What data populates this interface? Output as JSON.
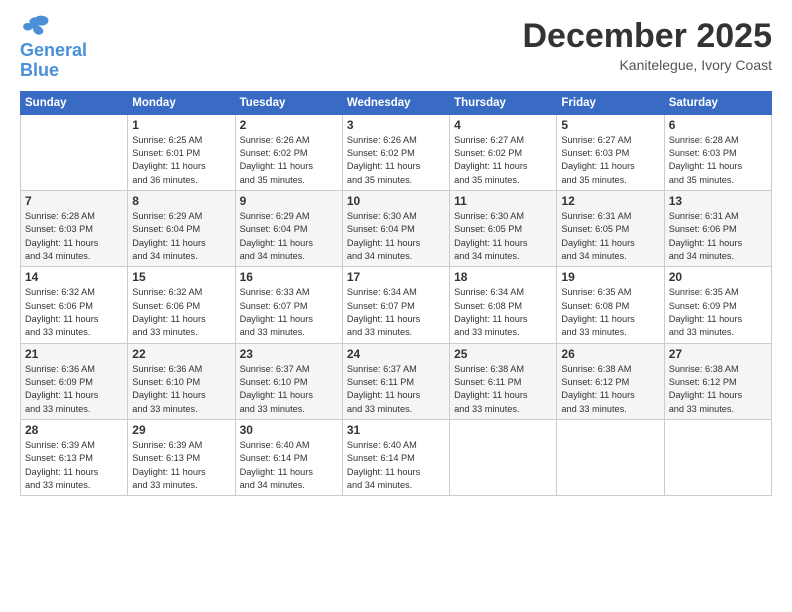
{
  "logo": {
    "line1": "General",
    "line2": "Blue"
  },
  "title": "December 2025",
  "subtitle": "Kanitelegue, Ivory Coast",
  "days_of_week": [
    "Sunday",
    "Monday",
    "Tuesday",
    "Wednesday",
    "Thursday",
    "Friday",
    "Saturday"
  ],
  "weeks": [
    [
      {
        "day": "",
        "info": ""
      },
      {
        "day": "1",
        "info": "Sunrise: 6:25 AM\nSunset: 6:01 PM\nDaylight: 11 hours\nand 36 minutes."
      },
      {
        "day": "2",
        "info": "Sunrise: 6:26 AM\nSunset: 6:02 PM\nDaylight: 11 hours\nand 35 minutes."
      },
      {
        "day": "3",
        "info": "Sunrise: 6:26 AM\nSunset: 6:02 PM\nDaylight: 11 hours\nand 35 minutes."
      },
      {
        "day": "4",
        "info": "Sunrise: 6:27 AM\nSunset: 6:02 PM\nDaylight: 11 hours\nand 35 minutes."
      },
      {
        "day": "5",
        "info": "Sunrise: 6:27 AM\nSunset: 6:03 PM\nDaylight: 11 hours\nand 35 minutes."
      },
      {
        "day": "6",
        "info": "Sunrise: 6:28 AM\nSunset: 6:03 PM\nDaylight: 11 hours\nand 35 minutes."
      }
    ],
    [
      {
        "day": "7",
        "info": "Sunrise: 6:28 AM\nSunset: 6:03 PM\nDaylight: 11 hours\nand 34 minutes."
      },
      {
        "day": "8",
        "info": "Sunrise: 6:29 AM\nSunset: 6:04 PM\nDaylight: 11 hours\nand 34 minutes."
      },
      {
        "day": "9",
        "info": "Sunrise: 6:29 AM\nSunset: 6:04 PM\nDaylight: 11 hours\nand 34 minutes."
      },
      {
        "day": "10",
        "info": "Sunrise: 6:30 AM\nSunset: 6:04 PM\nDaylight: 11 hours\nand 34 minutes."
      },
      {
        "day": "11",
        "info": "Sunrise: 6:30 AM\nSunset: 6:05 PM\nDaylight: 11 hours\nand 34 minutes."
      },
      {
        "day": "12",
        "info": "Sunrise: 6:31 AM\nSunset: 6:05 PM\nDaylight: 11 hours\nand 34 minutes."
      },
      {
        "day": "13",
        "info": "Sunrise: 6:31 AM\nSunset: 6:06 PM\nDaylight: 11 hours\nand 34 minutes."
      }
    ],
    [
      {
        "day": "14",
        "info": "Sunrise: 6:32 AM\nSunset: 6:06 PM\nDaylight: 11 hours\nand 33 minutes."
      },
      {
        "day": "15",
        "info": "Sunrise: 6:32 AM\nSunset: 6:06 PM\nDaylight: 11 hours\nand 33 minutes."
      },
      {
        "day": "16",
        "info": "Sunrise: 6:33 AM\nSunset: 6:07 PM\nDaylight: 11 hours\nand 33 minutes."
      },
      {
        "day": "17",
        "info": "Sunrise: 6:34 AM\nSunset: 6:07 PM\nDaylight: 11 hours\nand 33 minutes."
      },
      {
        "day": "18",
        "info": "Sunrise: 6:34 AM\nSunset: 6:08 PM\nDaylight: 11 hours\nand 33 minutes."
      },
      {
        "day": "19",
        "info": "Sunrise: 6:35 AM\nSunset: 6:08 PM\nDaylight: 11 hours\nand 33 minutes."
      },
      {
        "day": "20",
        "info": "Sunrise: 6:35 AM\nSunset: 6:09 PM\nDaylight: 11 hours\nand 33 minutes."
      }
    ],
    [
      {
        "day": "21",
        "info": "Sunrise: 6:36 AM\nSunset: 6:09 PM\nDaylight: 11 hours\nand 33 minutes."
      },
      {
        "day": "22",
        "info": "Sunrise: 6:36 AM\nSunset: 6:10 PM\nDaylight: 11 hours\nand 33 minutes."
      },
      {
        "day": "23",
        "info": "Sunrise: 6:37 AM\nSunset: 6:10 PM\nDaylight: 11 hours\nand 33 minutes."
      },
      {
        "day": "24",
        "info": "Sunrise: 6:37 AM\nSunset: 6:11 PM\nDaylight: 11 hours\nand 33 minutes."
      },
      {
        "day": "25",
        "info": "Sunrise: 6:38 AM\nSunset: 6:11 PM\nDaylight: 11 hours\nand 33 minutes."
      },
      {
        "day": "26",
        "info": "Sunrise: 6:38 AM\nSunset: 6:12 PM\nDaylight: 11 hours\nand 33 minutes."
      },
      {
        "day": "27",
        "info": "Sunrise: 6:38 AM\nSunset: 6:12 PM\nDaylight: 11 hours\nand 33 minutes."
      }
    ],
    [
      {
        "day": "28",
        "info": "Sunrise: 6:39 AM\nSunset: 6:13 PM\nDaylight: 11 hours\nand 33 minutes."
      },
      {
        "day": "29",
        "info": "Sunrise: 6:39 AM\nSunset: 6:13 PM\nDaylight: 11 hours\nand 33 minutes."
      },
      {
        "day": "30",
        "info": "Sunrise: 6:40 AM\nSunset: 6:14 PM\nDaylight: 11 hours\nand 34 minutes."
      },
      {
        "day": "31",
        "info": "Sunrise: 6:40 AM\nSunset: 6:14 PM\nDaylight: 11 hours\nand 34 minutes."
      },
      {
        "day": "",
        "info": ""
      },
      {
        "day": "",
        "info": ""
      },
      {
        "day": "",
        "info": ""
      }
    ]
  ]
}
